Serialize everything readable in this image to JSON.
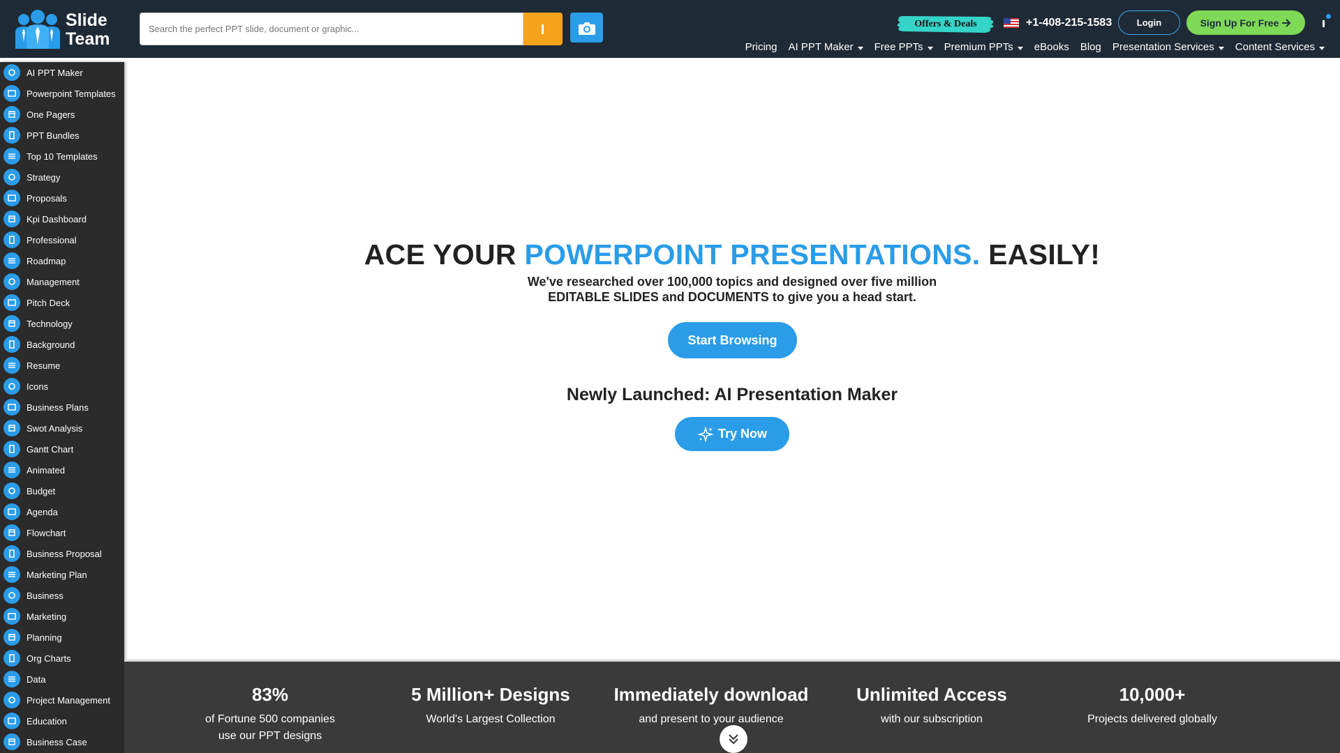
{
  "brand": {
    "logo_line1": "Slide",
    "logo_line2": "Team"
  },
  "search": {
    "placeholder": "Search the perfect PPT slide, document or graphic..."
  },
  "header": {
    "offers_label": "Offers & Deals",
    "phone": "+1-408-215-1583",
    "login_label": "Login",
    "signup_label": "Sign Up For Free"
  },
  "nav": {
    "items": [
      {
        "label": "Pricing"
      },
      {
        "label": "AI PPT Maker"
      },
      {
        "label": "Free PPTs"
      },
      {
        "label": "Premium PPTs"
      },
      {
        "label": "eBooks"
      },
      {
        "label": "Blog"
      },
      {
        "label": "Presentation Services"
      },
      {
        "label": "Content Services"
      }
    ]
  },
  "sidebar": {
    "items": [
      {
        "label": "AI PPT Maker"
      },
      {
        "label": "Powerpoint Templates"
      },
      {
        "label": "One Pagers"
      },
      {
        "label": "PPT Bundles"
      },
      {
        "label": "Top 10 Templates"
      },
      {
        "label": "Strategy"
      },
      {
        "label": "Proposals"
      },
      {
        "label": "Kpi Dashboard"
      },
      {
        "label": "Professional"
      },
      {
        "label": "Roadmap"
      },
      {
        "label": "Management"
      },
      {
        "label": "Pitch Deck"
      },
      {
        "label": "Technology"
      },
      {
        "label": "Background"
      },
      {
        "label": "Resume"
      },
      {
        "label": "Icons"
      },
      {
        "label": "Business Plans"
      },
      {
        "label": "Swot Analysis"
      },
      {
        "label": "Gantt Chart"
      },
      {
        "label": "Animated"
      },
      {
        "label": "Budget"
      },
      {
        "label": "Agenda"
      },
      {
        "label": "Flowchart"
      },
      {
        "label": "Business Proposal"
      },
      {
        "label": "Marketing Plan"
      },
      {
        "label": "Business"
      },
      {
        "label": "Marketing"
      },
      {
        "label": "Planning"
      },
      {
        "label": "Org Charts"
      },
      {
        "label": "Data"
      },
      {
        "label": "Project Management"
      },
      {
        "label": "Education"
      },
      {
        "label": "Business Case"
      }
    ]
  },
  "hero": {
    "title_part1": "ACE YOUR ",
    "title_highlight": "POWERPOINT PRESENTATIONS.",
    "title_part2": " EASILY!",
    "subtitle_line1": "We've researched over 100,000 topics and designed over five million",
    "subtitle_line2": "EDITABLE SLIDES and DOCUMENTS to give you a head start.",
    "browse_label": "Start Browsing",
    "newly_label": "Newly Launched: AI Presentation Maker",
    "try_label": "Try Now"
  },
  "stats": [
    {
      "title": "83%",
      "line1": "of Fortune 500 companies",
      "line2": "use our PPT designs"
    },
    {
      "title": "5 Million+ Designs",
      "line1": "World's Largest Collection",
      "line2": ""
    },
    {
      "title": "Immediately download",
      "line1": "and present to your audience",
      "line2": ""
    },
    {
      "title": "Unlimited Access",
      "line1": "with our subscription",
      "line2": ""
    },
    {
      "title": "10,000+",
      "line1": "Projects delivered globally",
      "line2": ""
    }
  ],
  "colors": {
    "header_bg": "#1e2a36",
    "accent_blue": "#2a9ce8",
    "accent_orange": "#f7a21b",
    "signup_green": "#7ed957",
    "sidebar_bg": "#2b2b2b",
    "stats_bg": "#3a3a3a"
  }
}
